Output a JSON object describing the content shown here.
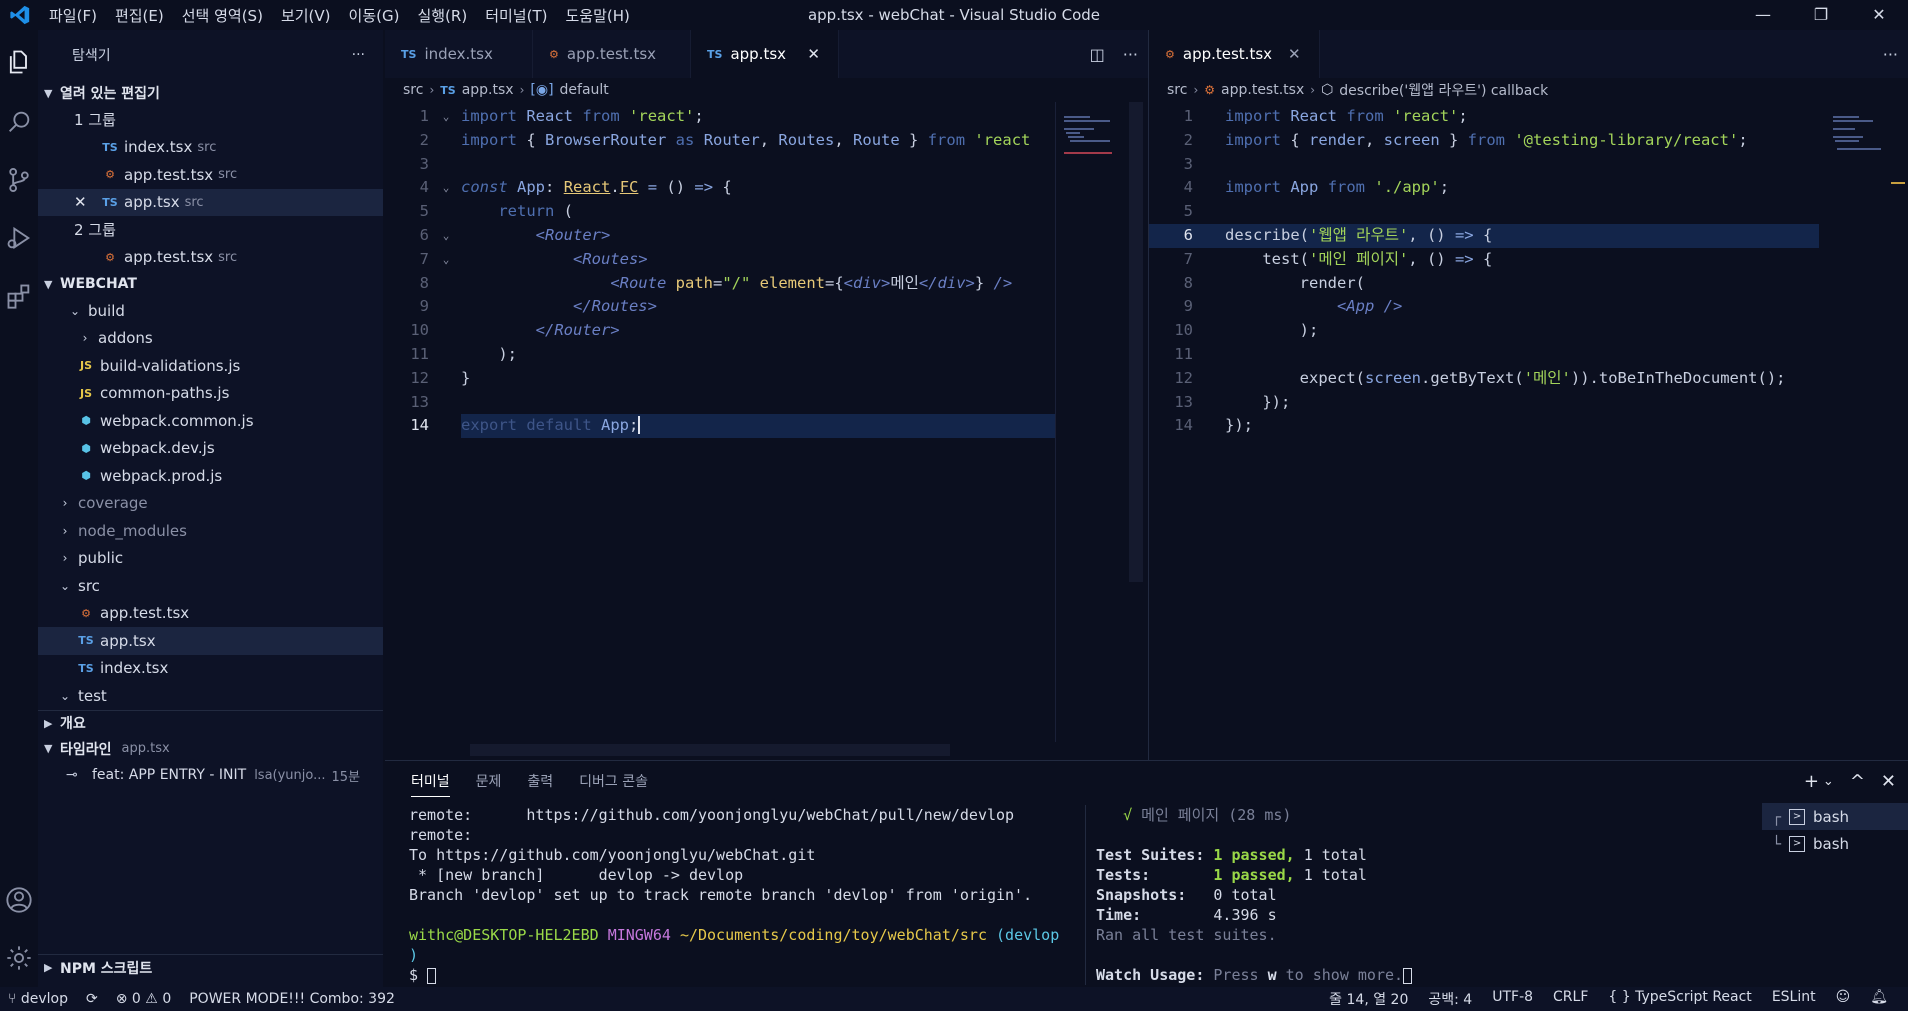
{
  "window": {
    "title": "app.tsx - webChat - Visual Studio Code",
    "menu": [
      "파일(F)",
      "편집(E)",
      "선택 영역(S)",
      "보기(V)",
      "이동(G)",
      "실행(R)",
      "터미널(T)",
      "도움말(H)"
    ],
    "controls": {
      "minimize": "—",
      "restore": "❐",
      "close": "✕"
    }
  },
  "activity": [
    "explorer-icon",
    "search-icon",
    "source-control-icon",
    "run-debug-icon",
    "extensions-icon",
    "account-icon",
    "settings-gear-icon"
  ],
  "sidebar": {
    "title": "탐색기",
    "more": "···",
    "open_editors": {
      "title": "열려 있는 편집기",
      "group1": "1 그룹",
      "group2": "2 그룹",
      "items": [
        {
          "icon": "TS",
          "name": "index.tsx",
          "desc": "src"
        },
        {
          "icon": "⚙",
          "name": "app.test.tsx",
          "desc": "src"
        },
        {
          "icon": "TS",
          "name": "app.tsx",
          "desc": "src",
          "close": "✕"
        },
        {
          "icon": "⚙",
          "name": "app.test.tsx",
          "desc": "src"
        }
      ]
    },
    "project": {
      "title": "WEBCHAT",
      "tree": {
        "build": "build",
        "addons": "addons",
        "build_validations": "build-validations.js",
        "common_paths": "common-paths.js",
        "webpack_common": "webpack.common.js",
        "webpack_dev": "webpack.dev.js",
        "webpack_prod": "webpack.prod.js",
        "coverage": "coverage",
        "node_modules": "node_modules",
        "public": "public",
        "src": "src",
        "app_test": "app.test.tsx",
        "app": "app.tsx",
        "index": "index.tsx",
        "test": "test"
      },
      "js_icon": "JS",
      "ts_icon": "TS"
    },
    "outline": {
      "title": "개요"
    },
    "timeline": {
      "title": "타임라인",
      "file": "app.tsx",
      "entry": "feat: APP ENTRY - INIT",
      "author": "lsa(yunjo...",
      "time": "15분"
    },
    "npm": {
      "title": "NPM 스크립트"
    }
  },
  "editor1": {
    "tabs": [
      {
        "icon": "TS",
        "label": "index.tsx"
      },
      {
        "icon": "⚙",
        "label": "app.test.tsx"
      },
      {
        "icon": "TS",
        "label": "app.tsx",
        "close": "✕"
      }
    ],
    "breadcrumb": {
      "a": "src",
      "b": "app.tsx",
      "c": "default"
    },
    "line_numbers": [
      "1",
      "2",
      "3",
      "4",
      "5",
      "6",
      "7",
      "8",
      "9",
      "10",
      "11",
      "12",
      "13",
      "14"
    ]
  },
  "editor2": {
    "tabs": [
      {
        "icon": "⚙",
        "label": "app.test.tsx",
        "close": "✕"
      }
    ],
    "breadcrumb": {
      "a": "src",
      "b": "app.test.tsx",
      "c": "describe('웹앱 라우트') callback"
    },
    "line_numbers": [
      "1",
      "2",
      "3",
      "4",
      "5",
      "6",
      "7",
      "8",
      "9",
      "10",
      "11",
      "12",
      "13",
      "14"
    ]
  },
  "panel": {
    "tabs": [
      "터미널",
      "문제",
      "출력",
      "디버그 콘솔"
    ],
    "actions": {
      "add": "+",
      "dropdown": "⌄",
      "maximize": "^",
      "close": "✕"
    },
    "terminal1": {
      "l1a": "remote:",
      "l1b": "https://github.com/yoonjonglyu/webChat/pull/new/devlop",
      "l2": "remote:",
      "l3": "To https://github.com/yoonjonglyu/webChat.git",
      "l4": " * [new branch]      devlop -> devlop",
      "l5": "Branch 'devlop' set up to track remote branch 'devlop' from 'origin'.",
      "prompt_user": "withc@DESKTOP-HEL2EBD",
      "prompt_env": "MINGW64",
      "prompt_path": "~/Documents/coding/toy/webChat/src",
      "prompt_branch": "(devlop",
      "prompt_branch_end": ")",
      "prompt": "$ "
    },
    "terminal2": {
      "check": "√",
      "test_name": "메인 페이지 (28 ms)",
      "suites_label": "Test Suites:",
      "suites_passed": "1 passed,",
      "suites_total": "1 total",
      "tests_label": "Tests:",
      "tests_passed": "1 passed,",
      "tests_total": "1 total",
      "snap_label": "Snapshots:",
      "snap_val": "0 total",
      "time_label": "Time:",
      "time_val": "4.396 s",
      "ran": "Ran all test suites.",
      "watch_label": "Watch Usage:",
      "watch_pre": "Press",
      "watch_key": "w",
      "watch_post": "to show more."
    },
    "terminal_list": [
      "bash",
      "bash"
    ]
  },
  "statusbar": {
    "branch": "devlop",
    "errors": "0",
    "warnings": "0",
    "power_mode": "POWER MODE!!! Combo: 392",
    "position": "줄 14, 열 20",
    "spaces": "공백: 4",
    "encoding": "UTF-8",
    "eol": "CRLF",
    "language": "TypeScript React",
    "eslint": "ESLint"
  },
  "colors": {
    "accent": "#1e8fe8",
    "selection": "#13254a",
    "string": "#a3d45a"
  }
}
